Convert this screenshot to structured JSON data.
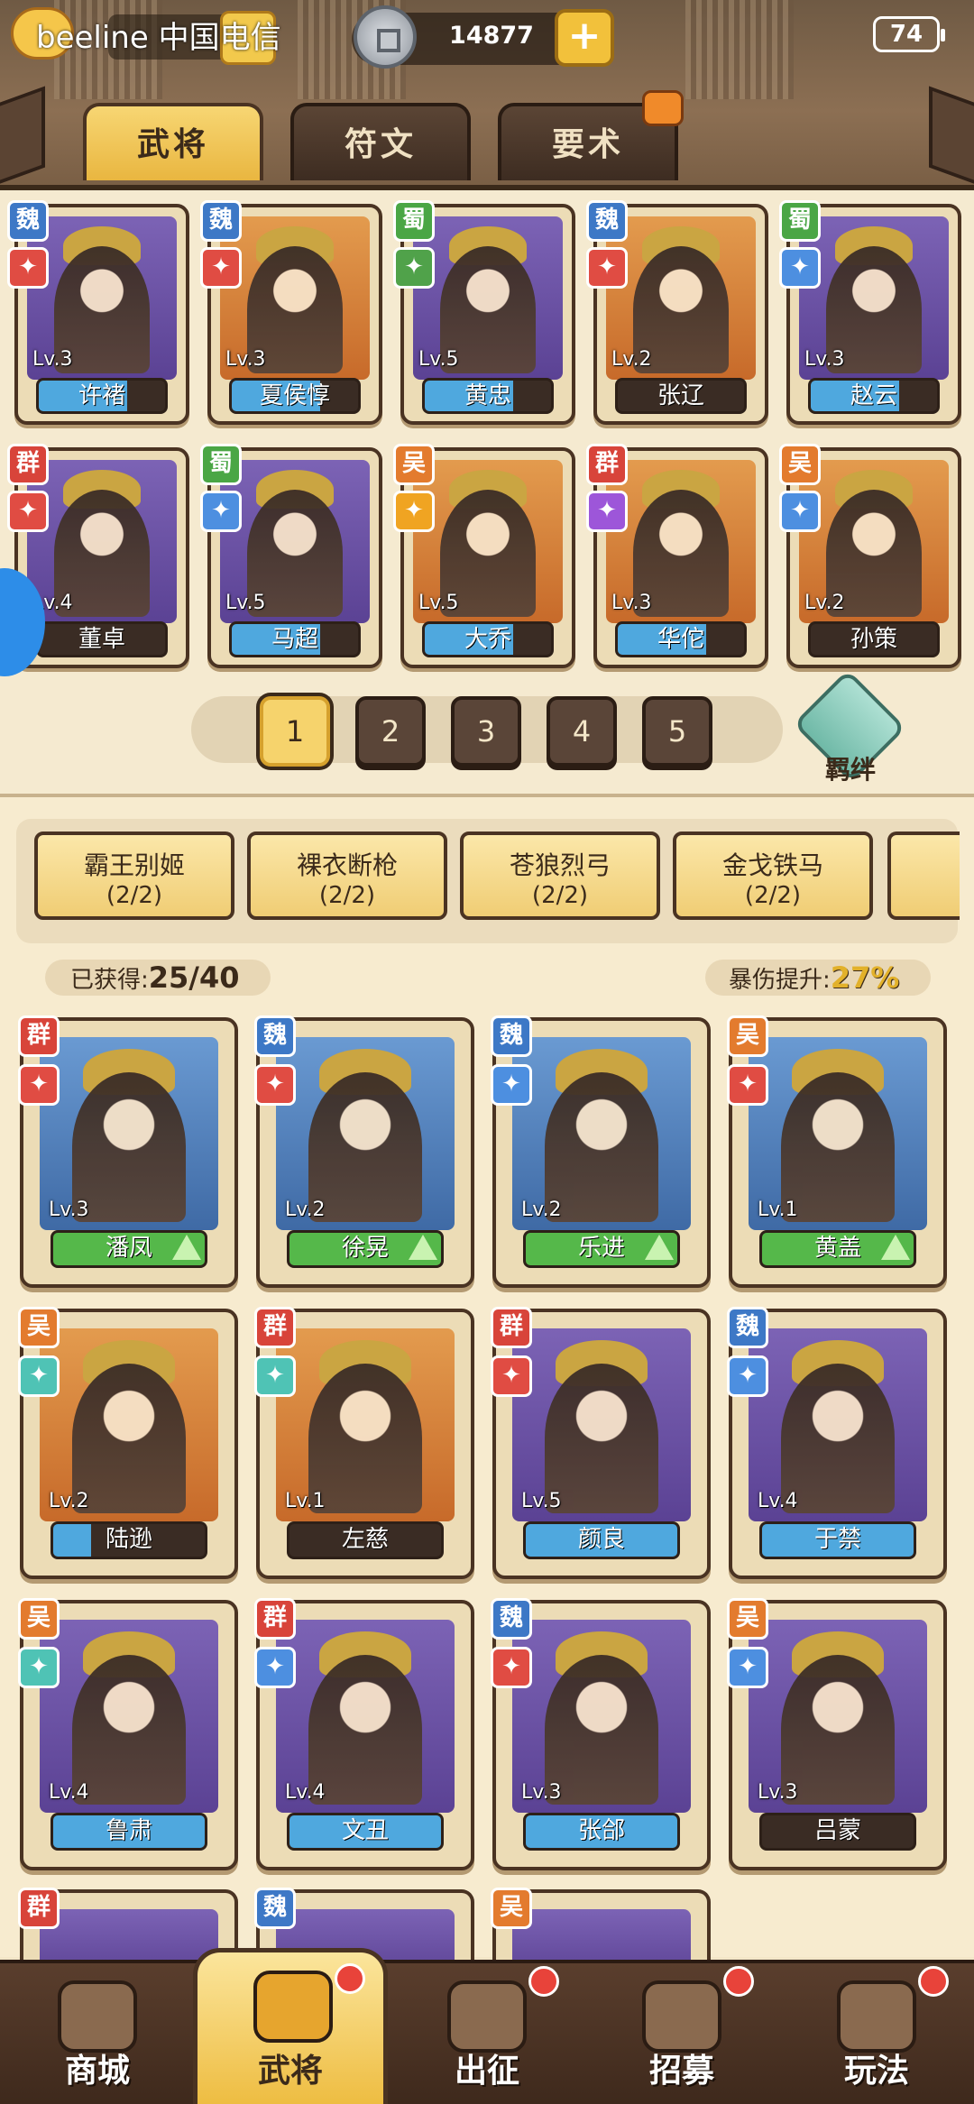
{
  "status": {
    "carrier": "beeline 中国电信",
    "battery": "74"
  },
  "header": {
    "coins": "14877",
    "plus": "+"
  },
  "tabs": [
    "武将",
    "符文",
    "要术"
  ],
  "top_heroes": [
    {
      "faction": "魏",
      "fc": "wei",
      "cls": "red",
      "art": "purple",
      "lv": "Lv.3",
      "name": "许褚",
      "fill": "#4fa8de",
      "pct": "70%"
    },
    {
      "faction": "魏",
      "fc": "wei",
      "cls": "red",
      "art": "orange",
      "lv": "Lv.3",
      "name": "夏侯惇",
      "fill": "#4fa8de",
      "pct": "70%"
    },
    {
      "faction": "蜀",
      "fc": "shu",
      "cls": "green",
      "art": "purple",
      "lv": "Lv.5",
      "name": "黄忠",
      "fill": "#4fa8de",
      "pct": "70%"
    },
    {
      "faction": "魏",
      "fc": "wei",
      "cls": "red",
      "art": "orange",
      "lv": "Lv.2",
      "name": "张辽",
      "fill": "#3a2c24",
      "pct": "0%"
    },
    {
      "faction": "蜀",
      "fc": "shu",
      "cls": "blue",
      "art": "purple",
      "lv": "Lv.3",
      "name": "赵云",
      "fill": "#4fa8de",
      "pct": "70%"
    },
    {
      "faction": "群",
      "fc": "qun",
      "cls": "red",
      "art": "purple",
      "lv": "Lv.4",
      "name": "董卓",
      "fill": "#3a2c24",
      "pct": "0%"
    },
    {
      "faction": "蜀",
      "fc": "shu",
      "cls": "blue",
      "art": "purple",
      "lv": "Lv.5",
      "name": "马超",
      "fill": "#4fa8de",
      "pct": "70%"
    },
    {
      "faction": "吴",
      "fc": "wu",
      "cls": "gold",
      "art": "orange",
      "lv": "Lv.5",
      "name": "大乔",
      "fill": "#4fa8de",
      "pct": "70%"
    },
    {
      "faction": "群",
      "fc": "qun",
      "cls": "purple",
      "art": "orange",
      "lv": "Lv.3",
      "name": "华佗",
      "fill": "#4fa8de",
      "pct": "70%"
    },
    {
      "faction": "吴",
      "fc": "wu",
      "cls": "blue",
      "art": "orange",
      "lv": "Lv.2",
      "name": "孙策",
      "fill": "#3a2c24",
      "pct": "0%"
    }
  ],
  "pager": {
    "pages": [
      "1",
      "2",
      "3",
      "4",
      "5"
    ],
    "active": 0,
    "bond_label": "羁绊"
  },
  "bonds": [
    {
      "name": "霸王别姬",
      "count": "(2/2)"
    },
    {
      "name": "裸衣断枪",
      "count": "(2/2)"
    },
    {
      "name": "苍狼烈弓",
      "count": "(2/2)"
    },
    {
      "name": "金戈铁马",
      "count": "(2/2)"
    }
  ],
  "stats": {
    "obtained_label": "已获得:",
    "obtained": "25/40",
    "crit_label": "暴伤提升:",
    "crit": "27%"
  },
  "collection": [
    {
      "faction": "群",
      "fc": "qun",
      "cls": "red",
      "art": "blue",
      "lv": "Lv.3",
      "name": "潘凤",
      "fill": "#55b84a",
      "pct": "100%",
      "up": true
    },
    {
      "faction": "魏",
      "fc": "wei",
      "cls": "red",
      "art": "blue",
      "lv": "Lv.2",
      "name": "徐晃",
      "fill": "#55b84a",
      "pct": "100%",
      "up": true
    },
    {
      "faction": "魏",
      "fc": "wei",
      "cls": "blue",
      "art": "blue",
      "lv": "Lv.2",
      "name": "乐进",
      "fill": "#55b84a",
      "pct": "100%",
      "up": true
    },
    {
      "faction": "吴",
      "fc": "wu",
      "cls": "red",
      "art": "blue",
      "lv": "Lv.1",
      "name": "黄盖",
      "fill": "#55b84a",
      "pct": "100%",
      "up": true
    },
    {
      "faction": "吴",
      "fc": "wu",
      "cls": "teal",
      "art": "orange",
      "lv": "Lv.2",
      "name": "陆逊",
      "fill": "#4fa8de",
      "pct": "25%",
      "up": false
    },
    {
      "faction": "群",
      "fc": "qun",
      "cls": "teal",
      "art": "orange",
      "lv": "Lv.1",
      "name": "左慈",
      "fill": "#3a2c24",
      "pct": "0%",
      "up": false
    },
    {
      "faction": "群",
      "fc": "qun",
      "cls": "red",
      "art": "purple",
      "lv": "Lv.5",
      "name": "颜良",
      "fill": "#4fa8de",
      "pct": "100%",
      "up": false
    },
    {
      "faction": "魏",
      "fc": "wei",
      "cls": "blue",
      "art": "purple",
      "lv": "Lv.4",
      "name": "于禁",
      "fill": "#4fa8de",
      "pct": "100%",
      "up": false
    },
    {
      "faction": "吴",
      "fc": "wu",
      "cls": "teal",
      "art": "purple",
      "lv": "Lv.4",
      "name": "鲁肃",
      "fill": "#4fa8de",
      "pct": "100%",
      "up": false
    },
    {
      "faction": "群",
      "fc": "qun",
      "cls": "blue",
      "art": "purple",
      "lv": "Lv.4",
      "name": "文丑",
      "fill": "#4fa8de",
      "pct": "100%",
      "up": false
    },
    {
      "faction": "魏",
      "fc": "wei",
      "cls": "red",
      "art": "purple",
      "lv": "Lv.3",
      "name": "张郃",
      "fill": "#4fa8de",
      "pct": "100%",
      "up": false
    },
    {
      "faction": "吴",
      "fc": "wu",
      "cls": "blue",
      "art": "purple",
      "lv": "Lv.3",
      "name": "吕蒙",
      "fill": "#3a2c24",
      "pct": "0%",
      "up": false
    }
  ],
  "partial_row": [
    {
      "faction": "群",
      "fc": "qun"
    },
    {
      "faction": "魏",
      "fc": "wei"
    },
    {
      "faction": "吴",
      "fc": "wu"
    }
  ],
  "nav": [
    {
      "label": "商城",
      "dot": false
    },
    {
      "label": "武将",
      "dot": true,
      "active": true
    },
    {
      "label": "出征",
      "dot": true
    },
    {
      "label": "招募",
      "dot": true
    },
    {
      "label": "玩法",
      "dot": true
    }
  ]
}
